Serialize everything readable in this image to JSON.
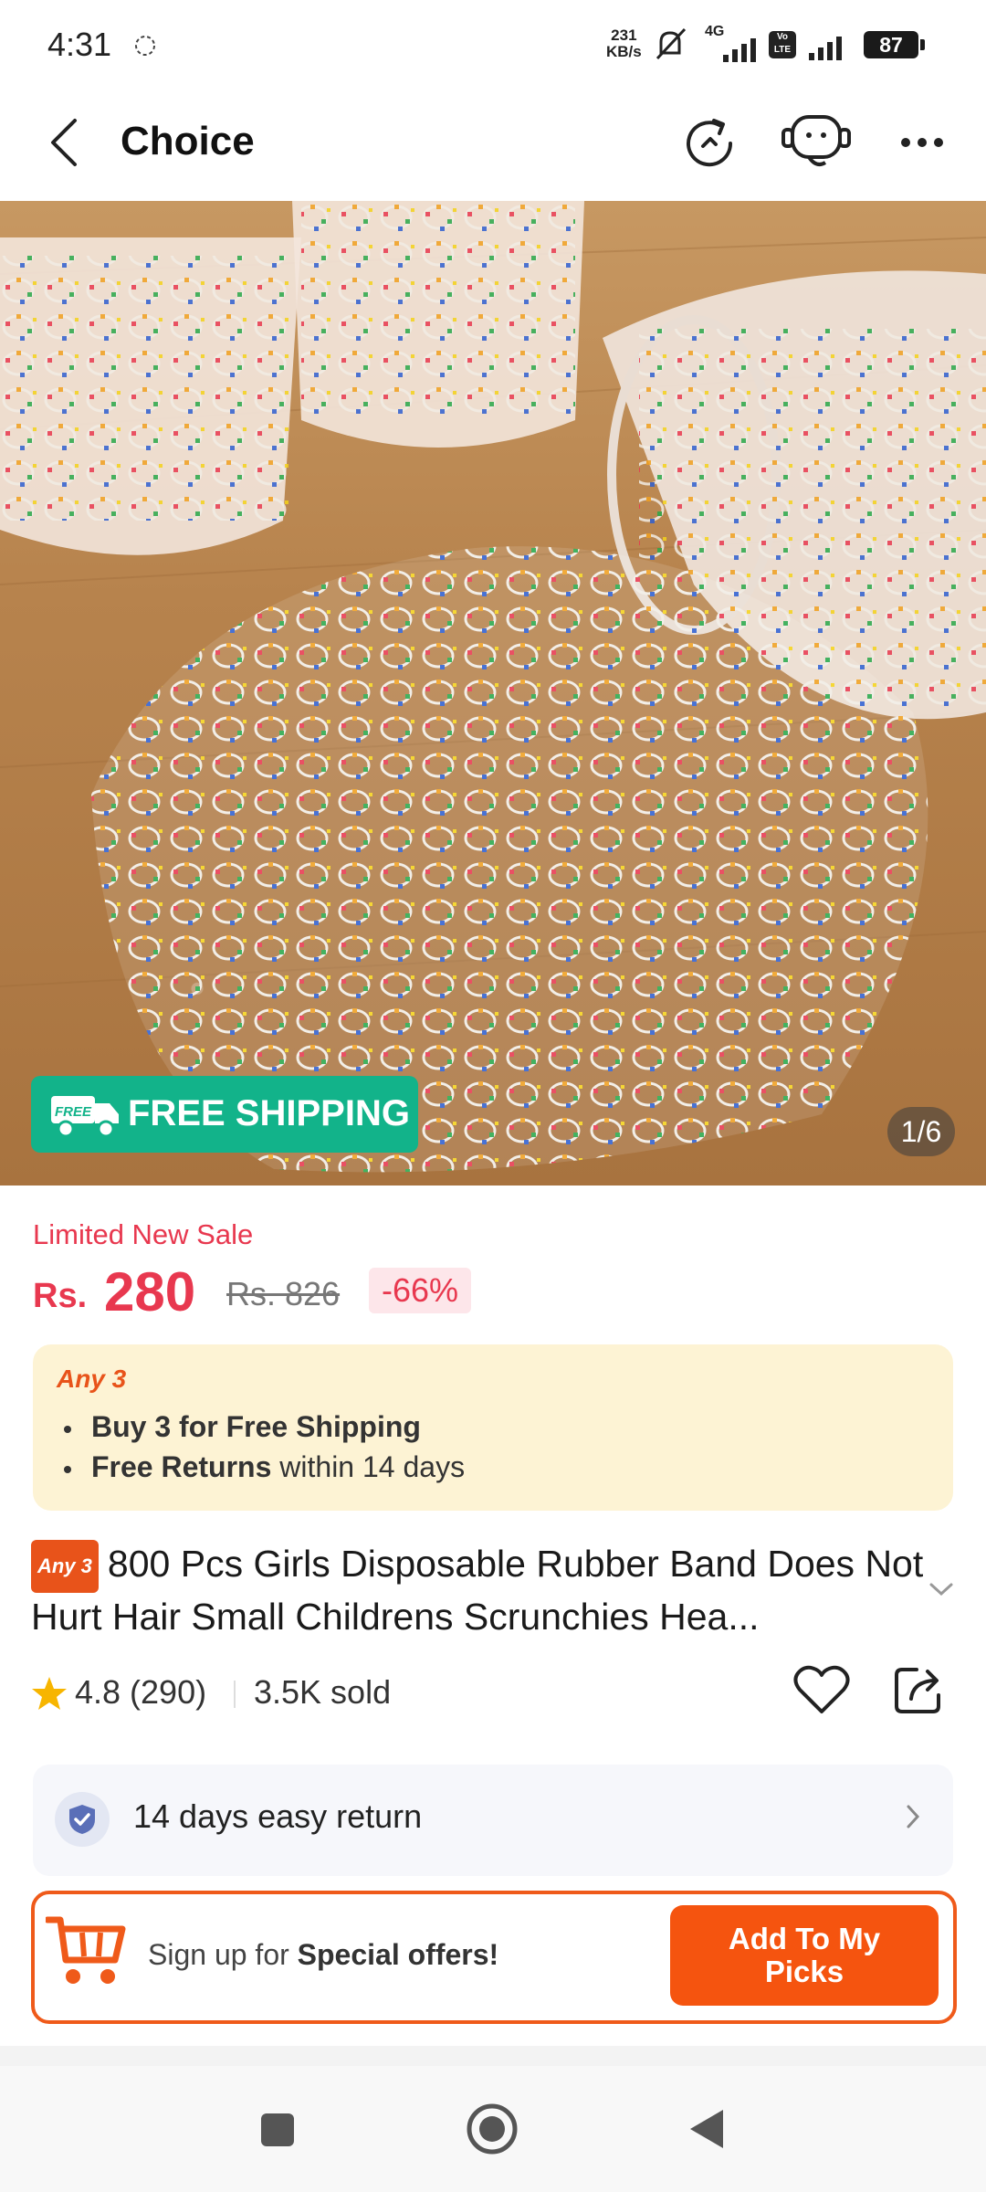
{
  "status_bar": {
    "time": "4:31",
    "net_speed_value": "231",
    "net_speed_unit": "KB/s",
    "network_label": "4G",
    "volte_label": "Vo LTE",
    "battery": "87"
  },
  "header": {
    "title": "Choice"
  },
  "gallery": {
    "badge_text": "FREE SHIPPING",
    "badge_icon_text": "FREE",
    "counter": "1/6"
  },
  "price": {
    "sale_label": "Limited New Sale",
    "currency": "Rs.",
    "current": "280",
    "original": "Rs. 826",
    "discount": "-66%"
  },
  "promo": {
    "tag": "Any 3",
    "line1_bold": "Buy 3 for  Free Shipping",
    "line2_bold": "Free Returns",
    "line2_rest": " within 14 days"
  },
  "product": {
    "tag": "Any 3",
    "title": "800 Pcs Girls Disposable Rubber Band Does Not Hurt Hair Small Childrens Scrunchies Hea..."
  },
  "rating": {
    "value": "4.8 (290)",
    "sold": "3.5K sold"
  },
  "return_policy": {
    "text": "14 days easy return"
  },
  "signup": {
    "text_prefix": "Sign up for ",
    "text_bold": "Special offers!",
    "button_label": "Add To My Picks"
  },
  "colors": {
    "accent_red": "#e8384f",
    "accent_orange": "#f5540f",
    "free_shipping_green": "#12b38a",
    "promo_bg": "#fdf3d4"
  },
  "icons": [
    "back-arrow-icon",
    "history-icon",
    "customer-service-icon",
    "more-icon",
    "star-icon",
    "heart-icon",
    "share-icon",
    "shield-check-icon",
    "chevron-right-icon",
    "chevron-down-icon",
    "shopping-cart-icon",
    "truck-icon"
  ]
}
